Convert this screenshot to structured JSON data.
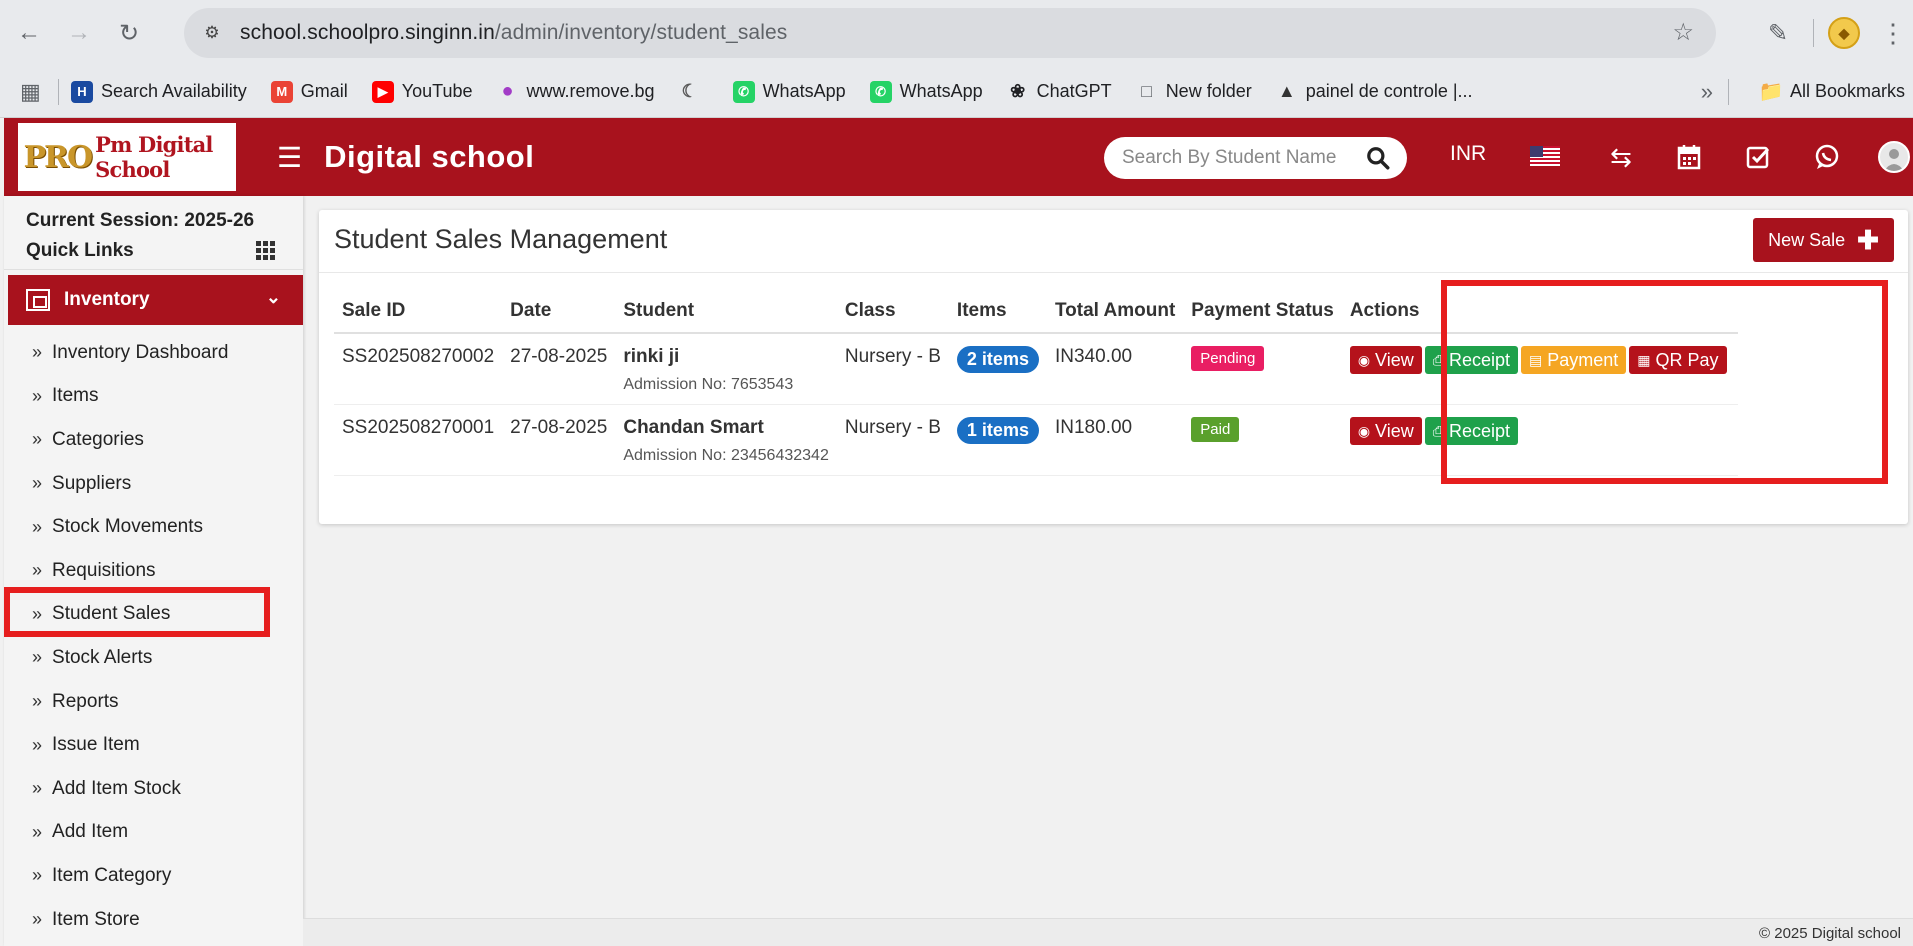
{
  "browser": {
    "url_host": "school.schoolpro.singinn.in",
    "url_path": "/admin/inventory/student_sales",
    "bookmarks": [
      {
        "label": "Search Availability",
        "icon": "hotel-icon",
        "color": "#1a4aa0"
      },
      {
        "label": "Gmail",
        "icon": "gmail-icon",
        "color": "#ea4335"
      },
      {
        "label": "YouTube",
        "icon": "youtube-icon",
        "color": "#ff0000"
      },
      {
        "label": "www.remove.bg",
        "icon": "removebg-icon",
        "color": "#a23cc7"
      },
      {
        "label": "",
        "icon": "moon-icon",
        "color": "#5a5a5a"
      },
      {
        "label": "WhatsApp",
        "icon": "whatsapp-icon",
        "color": "#25d366"
      },
      {
        "label": "WhatsApp",
        "icon": "whatsapp-icon",
        "color": "#25d366"
      },
      {
        "label": "ChatGPT",
        "icon": "chatgpt-icon",
        "color": "#202124"
      },
      {
        "label": "New folder",
        "icon": "folder-icon",
        "color": "#5f6368"
      },
      {
        "label": "painel de controle |...",
        "icon": "hat-icon",
        "color": "#333333"
      }
    ],
    "all_bookmarks": "All Bookmarks"
  },
  "header": {
    "logo_mark": "PRO",
    "logo_text": "Pm Digital School",
    "title": "Digital school",
    "search_placeholder": "Search By Student Name",
    "currency": "INR"
  },
  "sidebar": {
    "session": "Current Session: 2025-26",
    "quick_links": "Quick Links",
    "active_menu": "Inventory",
    "items": [
      "Inventory Dashboard",
      "Items",
      "Categories",
      "Suppliers",
      "Stock Movements",
      "Requisitions",
      "Student Sales",
      "Stock Alerts",
      "Reports",
      "Issue Item",
      "Add Item Stock",
      "Add Item",
      "Item Category",
      "Item Store"
    ]
  },
  "main": {
    "title": "Student Sales Management",
    "new_sale": "New Sale",
    "columns": [
      "Sale ID",
      "Date",
      "Student",
      "Class",
      "Items",
      "Total Amount",
      "Payment Status",
      "Actions"
    ],
    "rows": [
      {
        "sale_id": "SS202508270002",
        "date": "27-08-2025",
        "student": "rinki ji",
        "admission": "Admission No: 7653543",
        "class": "Nursery - B",
        "items": "2 items",
        "total": "IN340.00",
        "status": "Pending",
        "status_color": "#e91e63",
        "actions": [
          "View",
          "Receipt",
          "Payment",
          "QR Pay"
        ]
      },
      {
        "sale_id": "SS202508270001",
        "date": "27-08-2025",
        "student": "Chandan Smart",
        "admission": "Admission No: 23456432342",
        "class": "Nursery - B",
        "items": "1 items",
        "total": "IN180.00",
        "status": "Paid",
        "status_color": "#5aa02c",
        "actions": [
          "View",
          "Receipt"
        ]
      }
    ]
  },
  "footer": "© 2025 Digital school"
}
